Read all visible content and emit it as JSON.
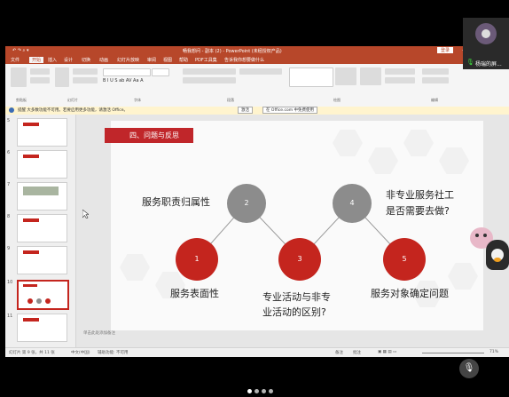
{
  "window": {
    "title": "畅我想问 - 副本 (2) - PowerPoint (未经授权产品)",
    "signin_label": "登录"
  },
  "menu": [
    "文件",
    "开始",
    "插入",
    "设计",
    "切换",
    "动画",
    "幻灯片放映",
    "审阅",
    "视图",
    "帮助",
    "PDF工具集",
    "告诉我你想要做什么"
  ],
  "ribbon_groups": [
    "剪贴板",
    "幻灯片",
    "字体",
    "段落",
    "绘图",
    "编辑"
  ],
  "notice": {
    "text": "提醒  大多数功能不可用。若要启用更多功能，请激活 Office。",
    "button1": "激活",
    "button2": "在 Office.com 中免费使用"
  },
  "thumbnails": [
    "5",
    "6",
    "7",
    "8",
    "9",
    "10",
    "11"
  ],
  "slide": {
    "banner": "四、问题与反思",
    "nodes": [
      {
        "num": "1",
        "label": "服务表面性"
      },
      {
        "num": "2",
        "label": "服务职责归属性"
      },
      {
        "num": "3",
        "label": "专业活动与非专业活动的区别?"
      },
      {
        "num": "4",
        "label": "非专业服务社工是否需要去做?"
      },
      {
        "num": "5",
        "label": "服务对象确定问题"
      }
    ],
    "label_lines": {
      "n3a": "专业活动与非专",
      "n3b": "业活动的区别?",
      "n4a": "非专业服务社工",
      "n4b": "是否需要去做?"
    }
  },
  "notes_placeholder": "单击此处添加备注",
  "status": {
    "slide_info": "幻灯片 第 9 张，共 11 张",
    "language": "中文(中国)",
    "accessibility": "辅助功能: 不可用",
    "notes": "备注",
    "comments": "批注",
    "zoom": "71%"
  },
  "participant": {
    "name": "杨瑞的屏...",
    "mic_icon": "mic-icon"
  },
  "colors": {
    "accent": "#c4251e",
    "gray_node": "#8c8c8c",
    "ppt_brand": "#b7472a"
  }
}
